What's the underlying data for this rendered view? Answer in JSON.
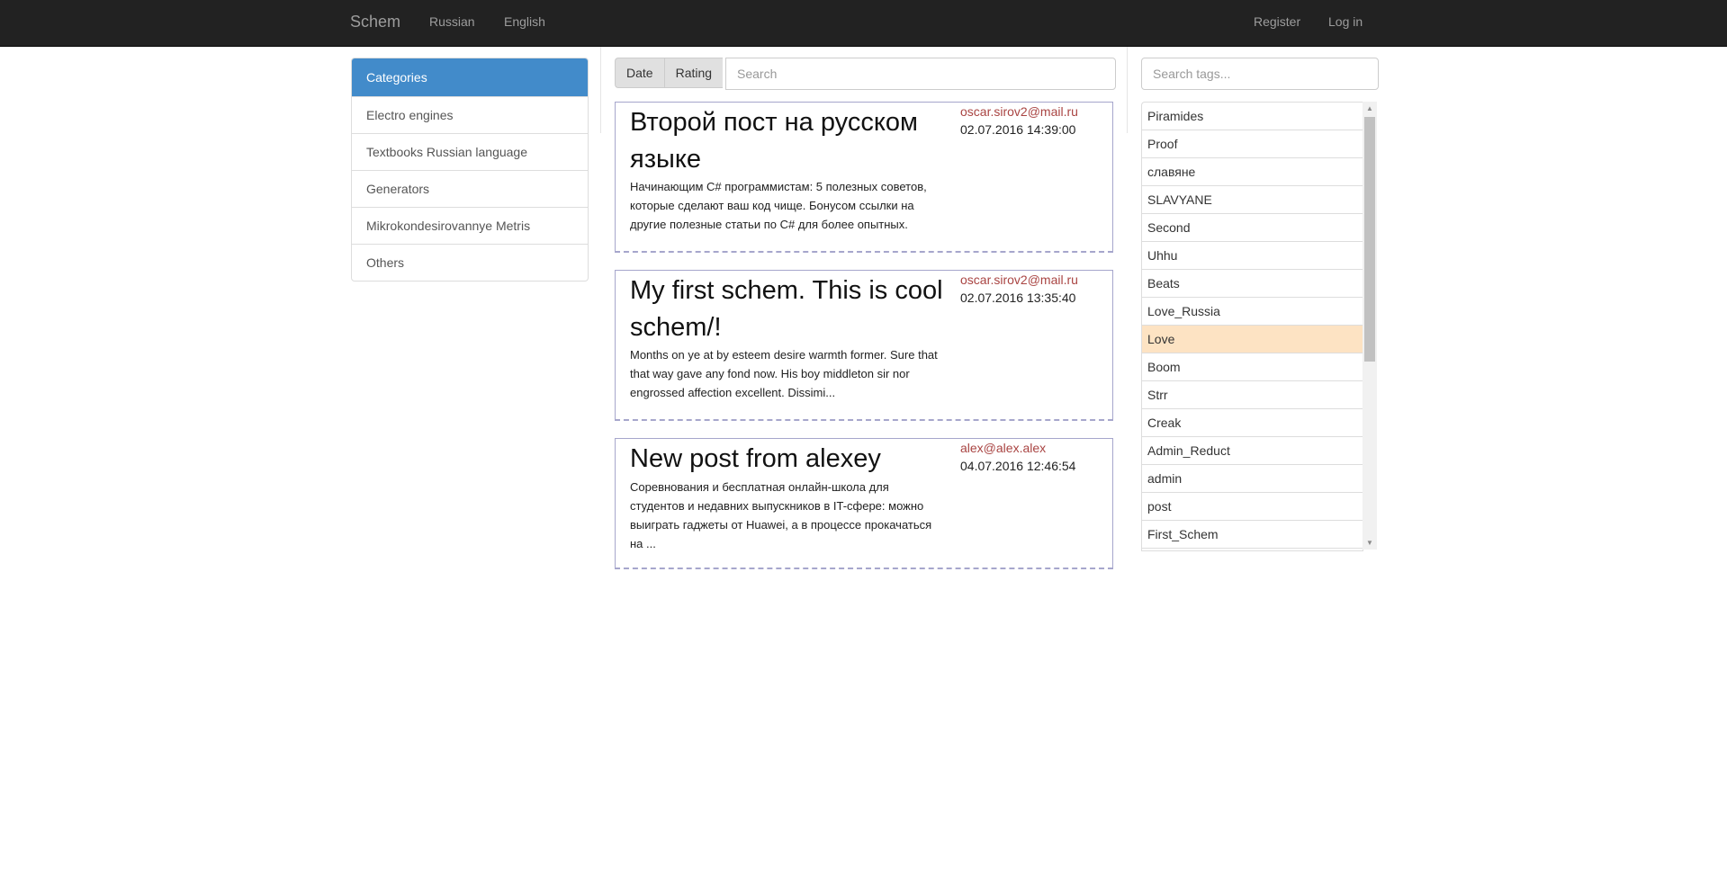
{
  "nav": {
    "brand": "Schem",
    "links": [
      "Russian",
      "English"
    ],
    "register": "Register",
    "login": "Log in"
  },
  "categories": {
    "title": "Categories",
    "items": [
      "Electro engines",
      "Textbooks Russian language",
      "Generators",
      "Mikrokondesirovannye Metris",
      "Others"
    ]
  },
  "toolbar": {
    "date": "Date",
    "rating": "Rating",
    "search_placeholder": "Search"
  },
  "posts": [
    {
      "title": "Второй пост на русском языке",
      "author": "oscar.sirov2@mail.ru",
      "date": "02.07.2016 14:39:00",
      "excerpt": "Начинающим C# программистам: 5 полезных советов, которые сделают ваш код чище. Бонусом ссылки на другие полезные статьи по C# для более опытных."
    },
    {
      "title": "My first schem. This is cool schem/!",
      "author": "oscar.sirov2@mail.ru",
      "date": "02.07.2016 13:35:40",
      "excerpt": "Months on ye at by esteem desire warmth former. Sure that that way gave any fond now. His boy middleton sir nor engrossed affection excellent. Dissimi..."
    },
    {
      "title": "New post from alexey",
      "author": "alex@alex.alex",
      "date": "04.07.2016 12:46:54",
      "excerpt": "Соревнования и бесплатная онлайн-школа для студентов и недавних выпускников в IT-сфере: можно выиграть гаджеты от Huawei, а в процессе прокачаться на ..."
    }
  ],
  "tags": {
    "search_placeholder": "Search tags...",
    "items": [
      "Piramides",
      "Proof",
      "славяне",
      "SLAVYANE",
      "Second",
      "Uhhu",
      "Beats",
      "Love_Russia",
      "Love",
      "Boom",
      "Strr",
      "Creak",
      "Admin_Reduct",
      "admin",
      "post",
      "First_Schem"
    ],
    "active": "Love"
  }
}
